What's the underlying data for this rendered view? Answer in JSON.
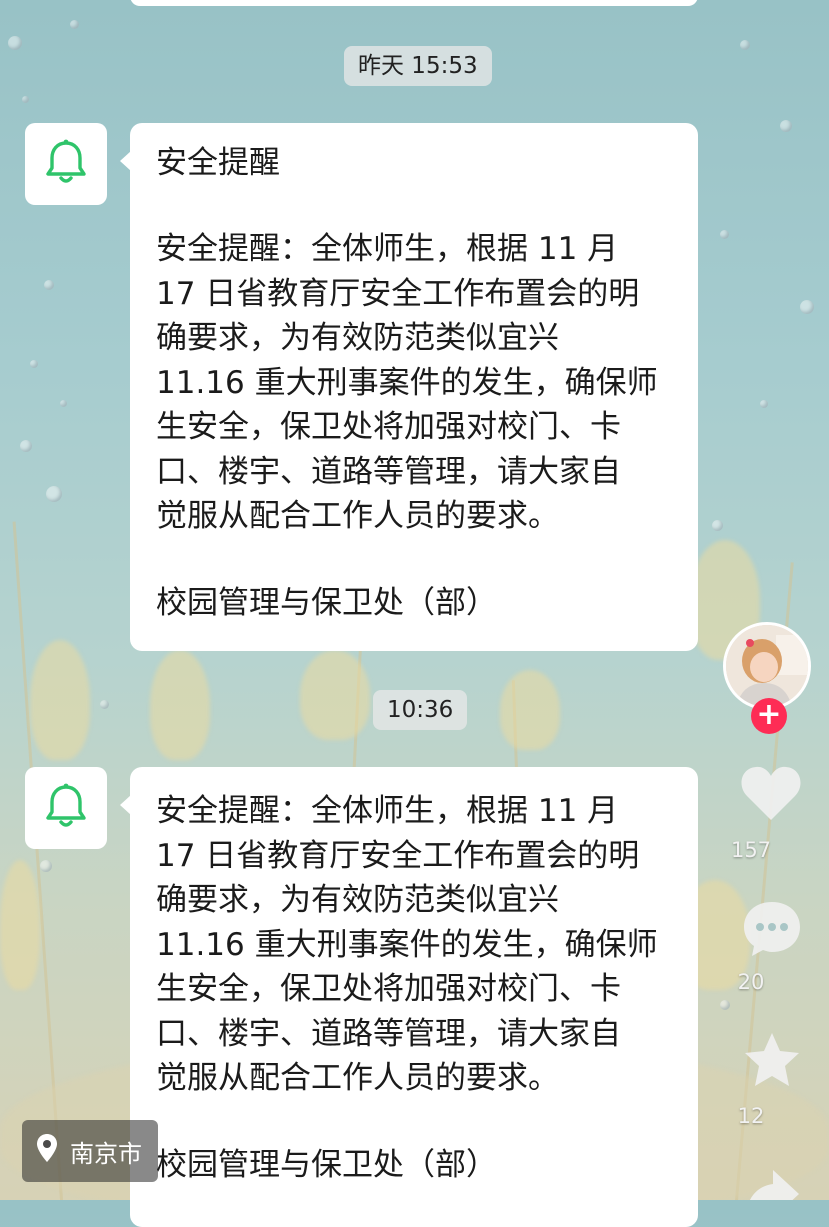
{
  "messages": [
    {
      "timestamp": "昨天 15:53",
      "title": "安全提醒",
      "body_lines": [
        "安全提醒：全体师生，根据 11 月",
        "17 日省教育厅安全工作布置会的明",
        "确要求，为有效防范类似宜兴",
        "11.16 重大刑事案件的发生，确保师",
        "生安全，保卫处将加强对校门、卡",
        "口、楼宇、道路等管理，请大家自",
        "觉服从配合工作人员的要求。"
      ],
      "signature": "校园管理与保卫处（部）"
    },
    {
      "timestamp": "10:36",
      "body_lines": [
        "安全提醒：全体师生，根据 11 月",
        "17 日省教育厅安全工作布置会的明",
        "确要求，为有效防范类似宜兴",
        "11.16 重大刑事案件的发生，确保师",
        "生安全，保卫处将加强对校门、卡",
        "口、楼宇、道路等管理，请大家自",
        "觉服从配合工作人员的要求。"
      ],
      "signature": "校园管理与保卫处（部）"
    }
  ],
  "sender_icon": "bell-icon",
  "actions": {
    "likes": "157",
    "comments": "20",
    "favorites": "12"
  },
  "location": "南京市",
  "colors": {
    "bell": "#2fc46a",
    "follow": "#fe2c55",
    "bubble": "#ffffff"
  }
}
